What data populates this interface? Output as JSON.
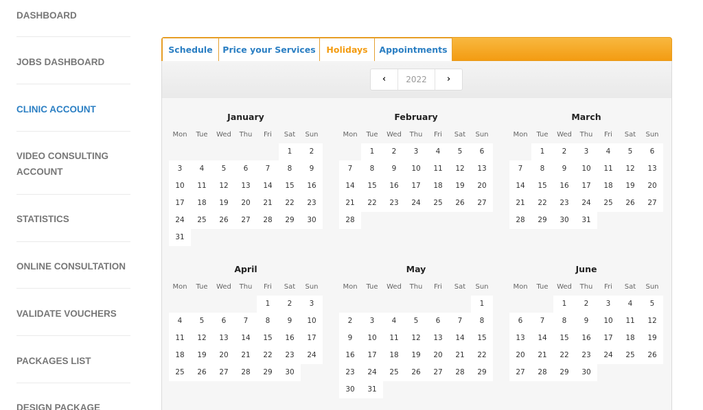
{
  "sidebar": {
    "items": [
      {
        "label": "DASHBOARD",
        "active": false
      },
      {
        "label": "JOBS DASHBOARD",
        "active": false
      },
      {
        "label": "CLINIC ACCOUNT",
        "active": true
      },
      {
        "label": "VIDEO CONSULTING ACCOUNT",
        "active": false
      },
      {
        "label": "STATISTICS",
        "active": false
      },
      {
        "label": "ONLINE CONSULTATION",
        "active": false
      },
      {
        "label": "VALIDATE VOUCHERS",
        "active": false
      },
      {
        "label": "PACKAGES LIST",
        "active": false
      },
      {
        "label": "DESIGN PACKAGE",
        "active": false
      }
    ]
  },
  "tabs": [
    {
      "label": "Schedule",
      "active": false
    },
    {
      "label": "Price your Services",
      "active": false
    },
    {
      "label": "Holidays",
      "active": true
    },
    {
      "label": "Appointments",
      "active": false
    }
  ],
  "year_nav": {
    "prev_icon": "chevron-left-icon",
    "next_icon": "chevron-right-icon",
    "prev_glyph": "‹",
    "next_glyph": "›",
    "year": "2022"
  },
  "weekdays": [
    "Mon",
    "Tue",
    "Wed",
    "Thu",
    "Fri",
    "Sat",
    "Sun"
  ],
  "months": [
    {
      "name": "January",
      "offset": 5,
      "days": 31
    },
    {
      "name": "February",
      "offset": 1,
      "days": 28
    },
    {
      "name": "March",
      "offset": 1,
      "days": 31
    },
    {
      "name": "April",
      "offset": 4,
      "days": 30
    },
    {
      "name": "May",
      "offset": 6,
      "days": 31
    },
    {
      "name": "June",
      "offset": 2,
      "days": 30
    }
  ],
  "colors": {
    "accent": "#f39c12",
    "link": "#2b7fc3"
  }
}
